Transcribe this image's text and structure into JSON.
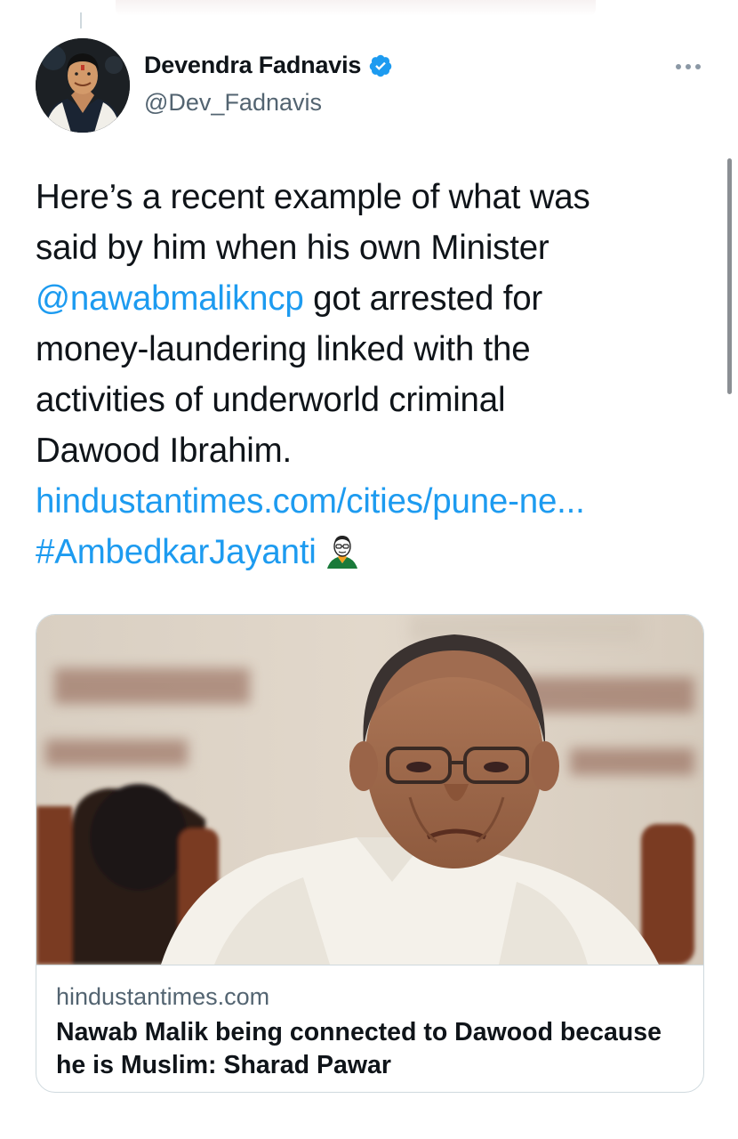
{
  "tweet": {
    "author_name": "Devendra Fadnavis",
    "author_handle": "@Dev_Fadnavis",
    "verified_icon": "verified-badge-icon",
    "more_icon": "more-options-icon",
    "text_lines": [
      "Here’s a recent example of what was",
      "said by him when his own Minister",
      "got arrested for",
      "money-laundering linked with the",
      "activities of underworld criminal",
      "Dawood Ibrahim."
    ],
    "mention": "@nawabmalikncp",
    "url_text": "hindustantimes.com/cities/pune-ne...",
    "hashtag": "#AmbedkarJayanti",
    "hashtag_emoji_icon": "ambedkar-hashflag-icon"
  },
  "card": {
    "domain": "hindustantimes.com",
    "title": "Nawab Malik being connected to Dawood because he is Muslim: Sharad Pawar"
  },
  "colors": {
    "text": "#0f1419",
    "secondary_text": "#536471",
    "link": "#1d9bf0",
    "border": "#cfd9de",
    "verified": "#1d9bf0"
  }
}
